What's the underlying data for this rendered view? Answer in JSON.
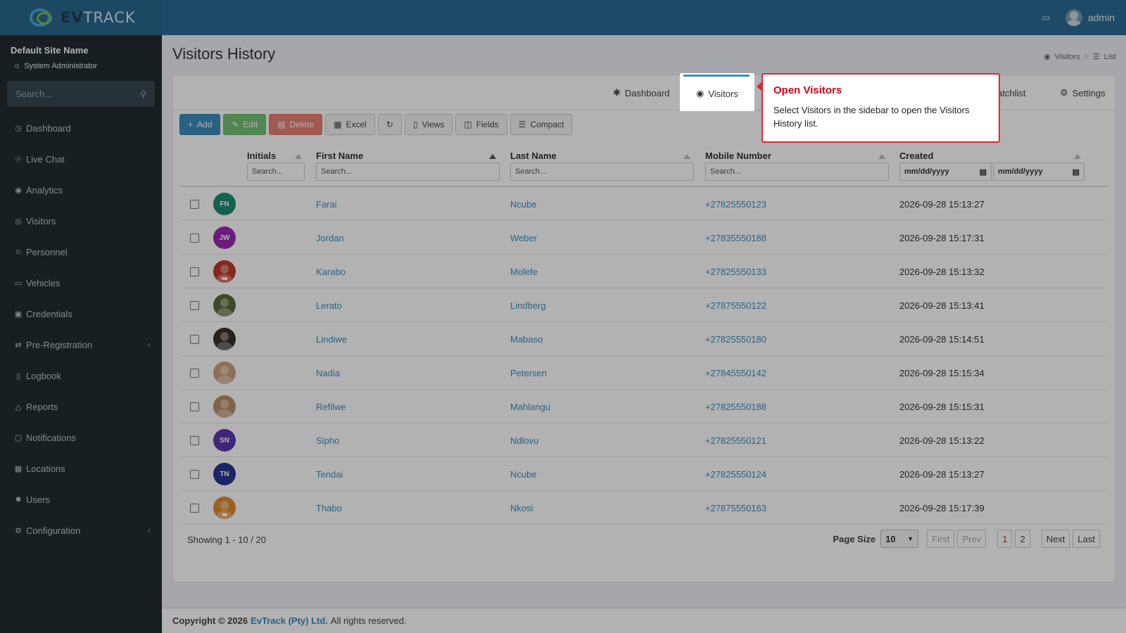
{
  "header": {
    "brand_a": "EV",
    "brand_b": "TRACK",
    "user": "admin"
  },
  "sidebar": {
    "site_name": "Default Site Name",
    "role": "System Administrator",
    "search_placeholder": "Search...",
    "items": [
      {
        "label": "Dashboard",
        "icon": "dashboard-icon"
      },
      {
        "label": "Live Chat",
        "icon": "headset-icon"
      },
      {
        "label": "Analytics",
        "icon": "analytics-icon"
      },
      {
        "label": "Visitors",
        "icon": "eye-icon"
      },
      {
        "label": "Personnel",
        "icon": "personnel-icon"
      },
      {
        "label": "Vehicles",
        "icon": "car-icon"
      },
      {
        "label": "Credentials",
        "icon": "credentials-icon"
      },
      {
        "label": "Pre-Registration",
        "icon": "exchange-icon"
      },
      {
        "label": "Logbook",
        "icon": "book-icon"
      },
      {
        "label": "Reports",
        "icon": "reports-icon"
      },
      {
        "label": "Notifications",
        "icon": "chat-icon"
      },
      {
        "label": "Locations",
        "icon": "building-icon"
      },
      {
        "label": "Users",
        "icon": "users-icon"
      },
      {
        "label": "Configuration",
        "icon": "gear-icon"
      }
    ]
  },
  "page": {
    "title": "Visitors History",
    "breadcrumb": [
      "Visitors",
      "List"
    ]
  },
  "tabs": {
    "dashboard": "Dashboard",
    "visitors": "Visitors",
    "watchlist": "atchlist",
    "settings": "Settings"
  },
  "toolbar": {
    "add": "Add",
    "edit": "Edit",
    "delete": "Delete",
    "excel": "Excel",
    "views": "Views",
    "fields": "Fields",
    "compact": "Compact"
  },
  "table": {
    "columns": {
      "initials": "Initials",
      "first_name": "First Name",
      "last_name": "Last Name",
      "mobile": "Mobile Number",
      "created": "Created"
    },
    "search_placeholder": "Search...",
    "date_placeholder": "mm/dd/yyyy",
    "rows": [
      {
        "initials": "FN",
        "first": "Farai",
        "last": "Ncube",
        "mobile": "+27825550123",
        "created": "2026-09-28 15:13:27",
        "color": "#1f8a70"
      },
      {
        "initials": "JW",
        "first": "Jordan",
        "last": "Weber",
        "mobile": "+27835550188",
        "created": "2026-09-28 15:17:31",
        "color": "#9b27af"
      },
      {
        "initials": "KM",
        "first": "Karabo",
        "last": "Molefe",
        "mobile": "+27825550133",
        "created": "2026-09-28 15:13:32",
        "color": "#c0392b"
      },
      {
        "initials": "",
        "first": "Lerato",
        "last": "Lindberg",
        "mobile": "+27875550122",
        "created": "2026-09-28 15:13:41",
        "color": "#5b6b3a"
      },
      {
        "initials": "",
        "first": "Lindiwe",
        "last": "Mabaso",
        "mobile": "+27825550180",
        "created": "2026-09-28 15:14:51",
        "color": "#3a2e28"
      },
      {
        "initials": "",
        "first": "Nadia",
        "last": "Petersen",
        "mobile": "+27845550142",
        "created": "2026-09-28 15:15:34",
        "color": "#c9a27e"
      },
      {
        "initials": "",
        "first": "Refilwe",
        "last": "Mahlangu",
        "mobile": "+27825550188",
        "created": "2026-09-28 15:15:31",
        "color": "#b98f6a"
      },
      {
        "initials": "SN",
        "first": "Sipho",
        "last": "Ndlovu",
        "mobile": "+27825550121",
        "created": "2026-09-28 15:13:22",
        "color": "#5e35b1"
      },
      {
        "initials": "TN",
        "first": "Tendai",
        "last": "Ncube",
        "mobile": "+27825550124",
        "created": "2026-09-28 15:13:27",
        "color": "#283593"
      },
      {
        "initials": "TH",
        "first": "Thabo",
        "last": "Nkosi",
        "mobile": "+27875550163",
        "created": "2026-09-28 15:17:39",
        "color": "#e08a2e"
      }
    ]
  },
  "pager": {
    "showing": "Showing 1 - 10 / 20",
    "page_size_label": "Page Size",
    "page_size": "10",
    "first": "First",
    "prev": "Prev",
    "page1": "1",
    "page2": "2",
    "next": "Next",
    "last": "Last"
  },
  "footer": {
    "copyright": "Copyright © 2026",
    "company": "EvTrack (Pty) Ltd.",
    "rights": "All rights reserved."
  },
  "callout": {
    "title": "Open Visitors",
    "body": "Select Visitors in the sidebar to open the Visitors History list."
  }
}
